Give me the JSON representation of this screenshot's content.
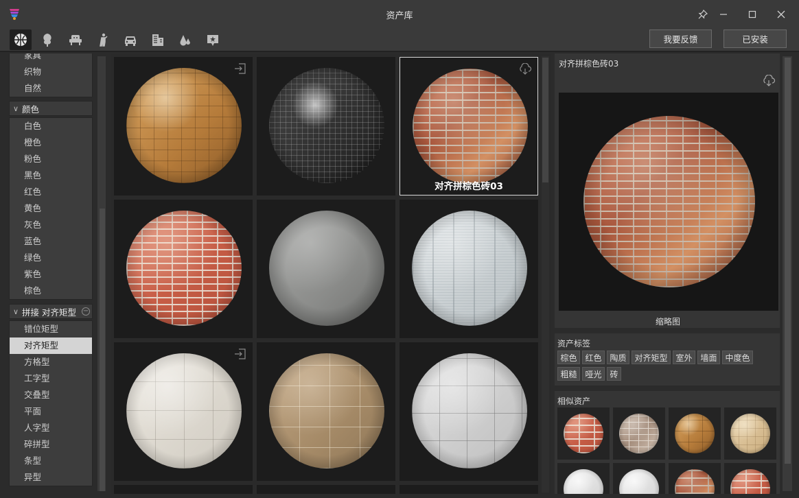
{
  "window": {
    "title": "资产库"
  },
  "toolbar": {
    "categories": [
      {
        "name": "material",
        "icon": "globe-icon",
        "active": true
      },
      {
        "name": "plant",
        "icon": "tree-icon",
        "active": false
      },
      {
        "name": "furniture",
        "icon": "armchair-icon",
        "active": false
      },
      {
        "name": "people",
        "icon": "person-icon",
        "active": false
      },
      {
        "name": "vehicle",
        "icon": "car-icon",
        "active": false
      },
      {
        "name": "building",
        "icon": "building-icon",
        "active": false
      },
      {
        "name": "effects",
        "icon": "drops-icon",
        "active": false
      },
      {
        "name": "decal",
        "icon": "sign-icon",
        "active": false
      }
    ],
    "feedback_label": "我要反馈",
    "installed_label": "已安装"
  },
  "sidebar": {
    "top_list": [
      "家具",
      "织物",
      "自然"
    ],
    "color_group": {
      "title": "颜色",
      "items": [
        "白色",
        "橙色",
        "粉色",
        "黑色",
        "红色",
        "黄色",
        "灰色",
        "蓝色",
        "绿色",
        "紫色",
        "棕色"
      ]
    },
    "pattern_group": {
      "title": "拼接 对齐矩型",
      "items": [
        "错位矩型",
        "对齐矩型",
        "方格型",
        "工字型",
        "交叠型",
        "平面",
        "人字型",
        "碎拼型",
        "条型",
        "异型"
      ],
      "selected": "对齐矩型"
    }
  },
  "grid": {
    "assets": [
      {
        "material": "wood",
        "label": "",
        "badge": "import-icon",
        "selected": false
      },
      {
        "material": "black",
        "label": "",
        "badge": "",
        "selected": false
      },
      {
        "material": "brick",
        "label": "对齐拼棕色砖03",
        "badge": "cloud-download-icon",
        "selected": true
      },
      {
        "material": "brick-red",
        "label": "",
        "badge": "",
        "selected": false
      },
      {
        "material": "concrete",
        "label": "",
        "badge": "",
        "selected": false
      },
      {
        "material": "perf",
        "label": "",
        "badge": "",
        "selected": false
      },
      {
        "material": "white",
        "label": "",
        "badge": "import-icon",
        "selected": false
      },
      {
        "material": "sandstone",
        "label": "",
        "badge": "",
        "selected": false
      },
      {
        "material": "grey-tile",
        "label": "",
        "badge": "",
        "selected": false
      }
    ]
  },
  "detail": {
    "title": "对齐拼棕色砖03",
    "thumbnail_label": "缩略图",
    "tags_title": "资产标签",
    "tags": [
      "棕色",
      "红色",
      "陶质",
      "对齐矩型",
      "室外",
      "墙面",
      "中度色",
      "粗糙",
      "哑光",
      "砖"
    ],
    "similar_title": "相似资产",
    "similar": [
      "brick-red",
      "stone-multi",
      "wood",
      "beige",
      "white-gloss",
      "white-gloss",
      "brick",
      "brick"
    ]
  }
}
